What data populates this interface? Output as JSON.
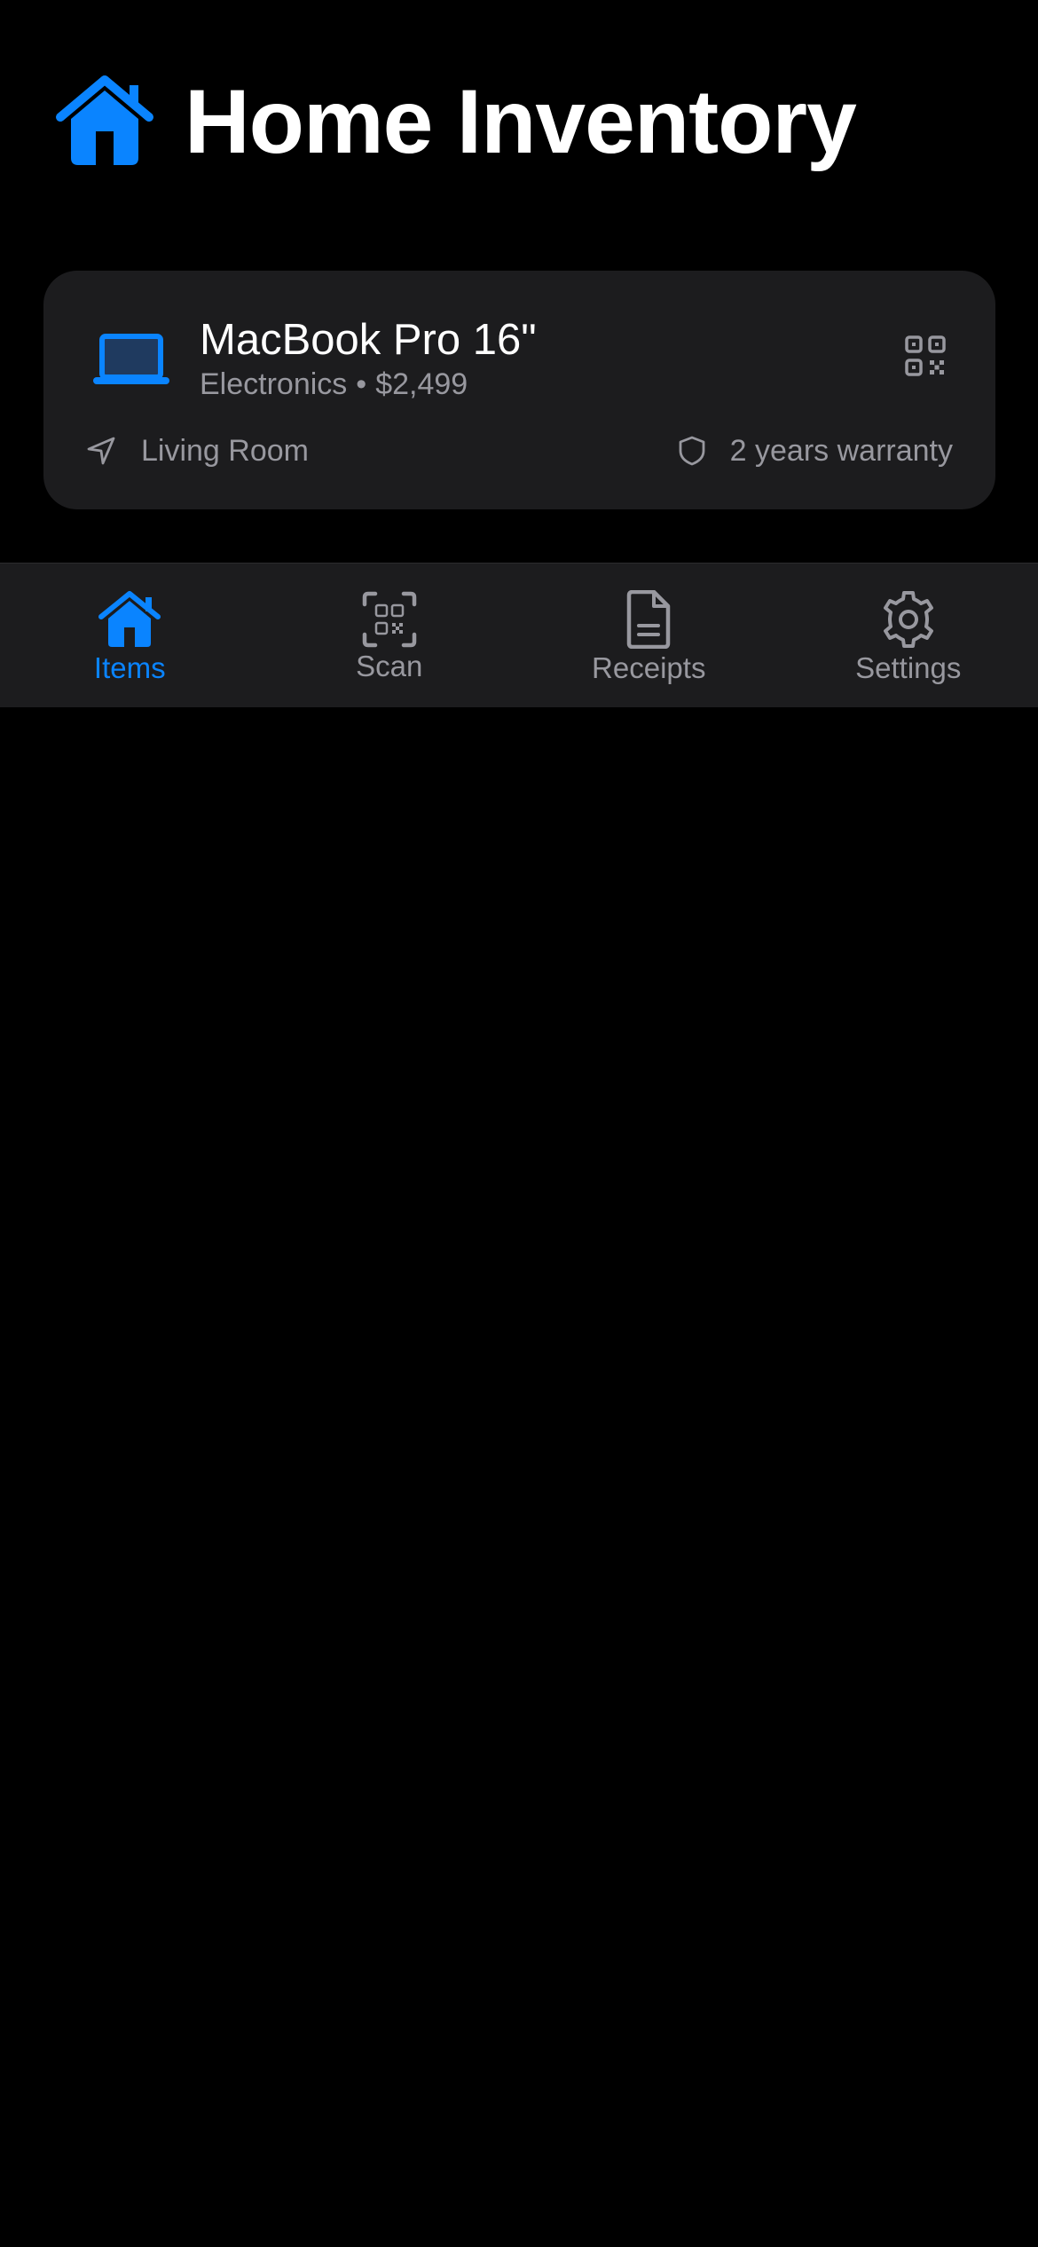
{
  "app": {
    "title": "Home Inventory",
    "logo_icon": "house-fill-icon",
    "accent_color": "#0a84ff"
  },
  "item": {
    "name": "MacBook Pro 16\"",
    "category": "Electronics",
    "separator": "•",
    "price": "$2,499",
    "icon": "laptop-icon",
    "location": "Living Room",
    "location_icon": "location-arrow-icon",
    "warranty": "2 years warranty",
    "warranty_icon": "shield-icon",
    "action_icon": "qr-code-icon"
  },
  "tabbar": {
    "tabs": [
      {
        "label": "Items",
        "icon": "house-fill-icon",
        "active": true
      },
      {
        "label": "Scan",
        "icon": "qr-scan-icon",
        "active": false
      },
      {
        "label": "Receipts",
        "icon": "document-icon",
        "active": false
      },
      {
        "label": "Settings",
        "icon": "gear-icon",
        "active": false
      }
    ]
  }
}
